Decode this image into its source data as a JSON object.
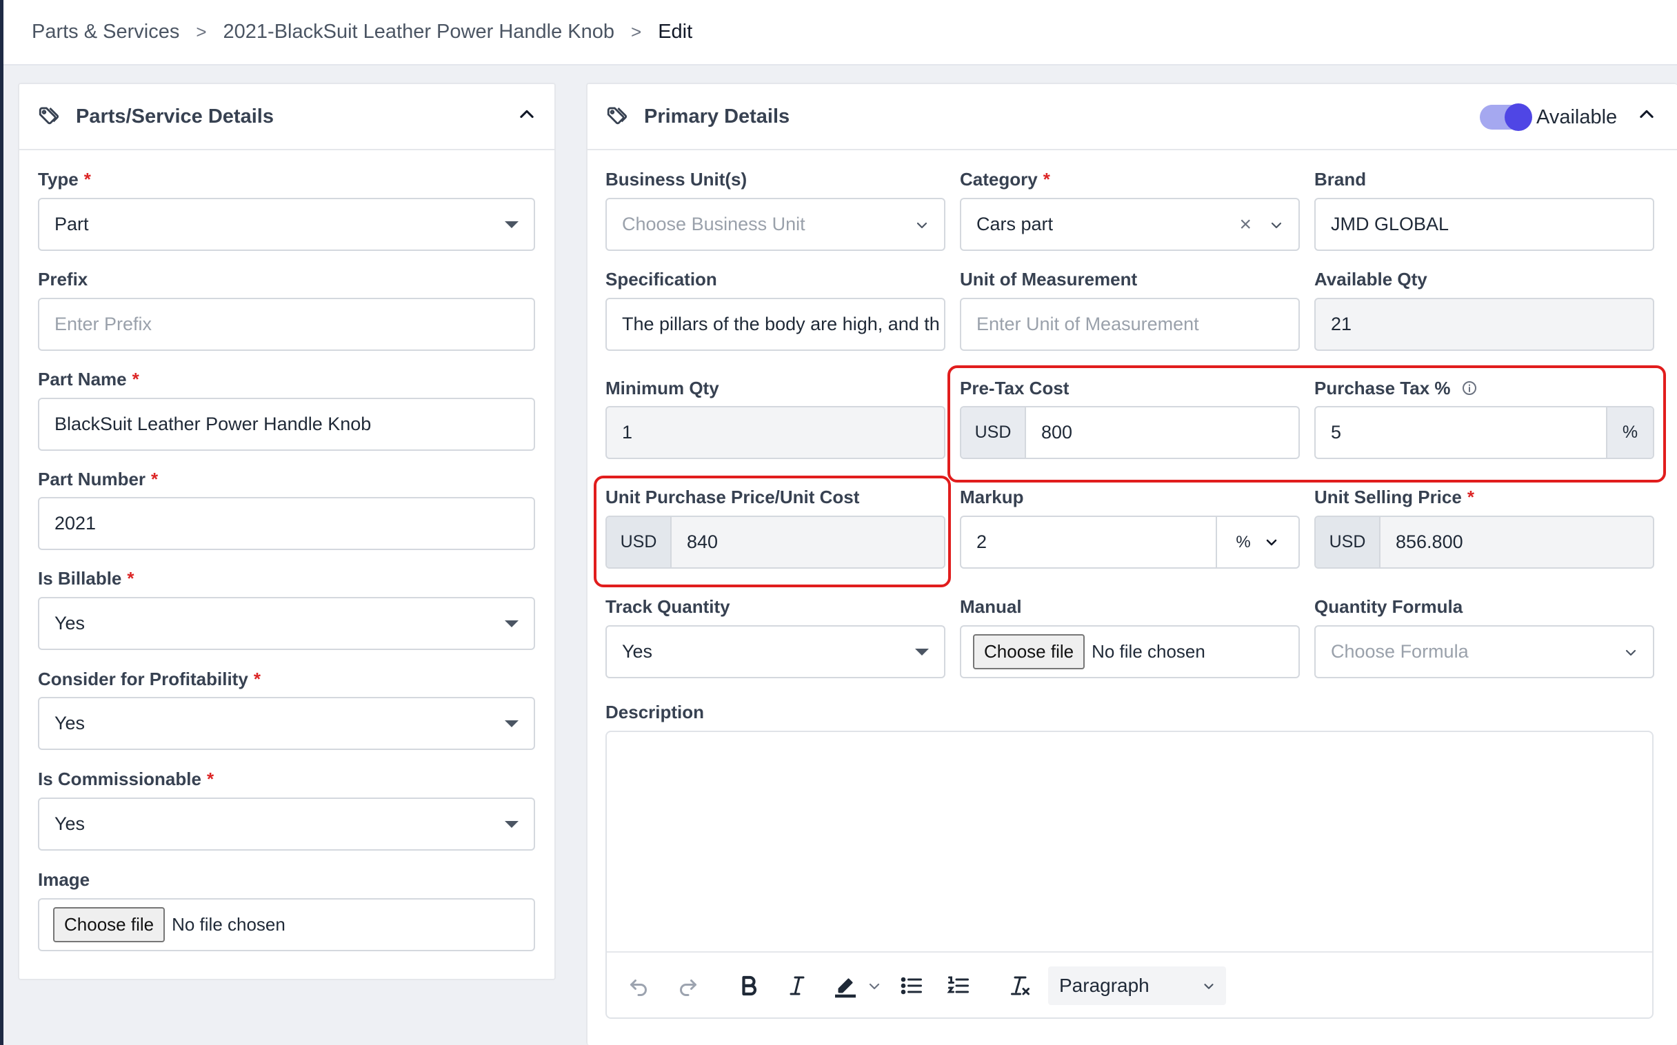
{
  "breadcrumb": {
    "items": [
      "Parts & Services",
      "2021-BlackSuit Leather Power Handle Knob",
      "Edit"
    ],
    "separator": ">"
  },
  "left_card": {
    "title": "Parts/Service Details",
    "fields": {
      "type": {
        "label": "Type",
        "value": "Part"
      },
      "prefix": {
        "label": "Prefix",
        "placeholder": "Enter Prefix"
      },
      "part_name": {
        "label": "Part Name",
        "value": "BlackSuit Leather Power Handle Knob"
      },
      "part_number": {
        "label": "Part Number",
        "value": "2021"
      },
      "is_billable": {
        "label": "Is Billable",
        "value": "Yes"
      },
      "profitability": {
        "label": "Consider for Profitability",
        "value": "Yes"
      },
      "commissionable": {
        "label": "Is Commissionable",
        "value": "Yes"
      },
      "image": {
        "label": "Image",
        "button": "Choose file",
        "status": "No file chosen"
      }
    }
  },
  "right_card": {
    "title": "Primary Details",
    "available_label": "Available",
    "available_on": true,
    "fields": {
      "business_unit": {
        "label": "Business Unit(s)",
        "placeholder": "Choose Business Unit"
      },
      "category": {
        "label": "Category",
        "value": "Cars part",
        "clear": "×"
      },
      "brand": {
        "label": "Brand",
        "value": "JMD GLOBAL"
      },
      "specification": {
        "label": "Specification",
        "value": "The pillars of the body are high, and th"
      },
      "uom": {
        "label": "Unit of Measurement",
        "placeholder": "Enter Unit of Measurement"
      },
      "available_qty": {
        "label": "Available Qty",
        "value": "21"
      },
      "min_qty": {
        "label": "Minimum Qty",
        "value": "1"
      },
      "pre_tax_cost": {
        "label": "Pre-Tax Cost",
        "currency": "USD",
        "value": "800"
      },
      "purchase_tax": {
        "label": "Purchase Tax %",
        "value": "5",
        "suffix": "%"
      },
      "unit_purchase_price": {
        "label": "Unit Purchase Price/Unit Cost",
        "currency": "USD",
        "value": "840"
      },
      "markup": {
        "label": "Markup",
        "value": "2",
        "unit": "%"
      },
      "unit_selling_price": {
        "label": "Unit Selling Price",
        "currency": "USD",
        "value": "856.800"
      },
      "track_quantity": {
        "label": "Track Quantity",
        "value": "Yes"
      },
      "manual": {
        "label": "Manual",
        "button": "Choose file",
        "status": "No file chosen"
      },
      "quantity_formula": {
        "label": "Quantity Formula",
        "placeholder": "Choose Formula"
      },
      "description": {
        "label": "Description",
        "format": "Paragraph"
      }
    }
  },
  "required_mark": "*",
  "colors": {
    "accent": "#4f46e5",
    "highlight": "#e11d1d",
    "required": "#dc2626"
  }
}
